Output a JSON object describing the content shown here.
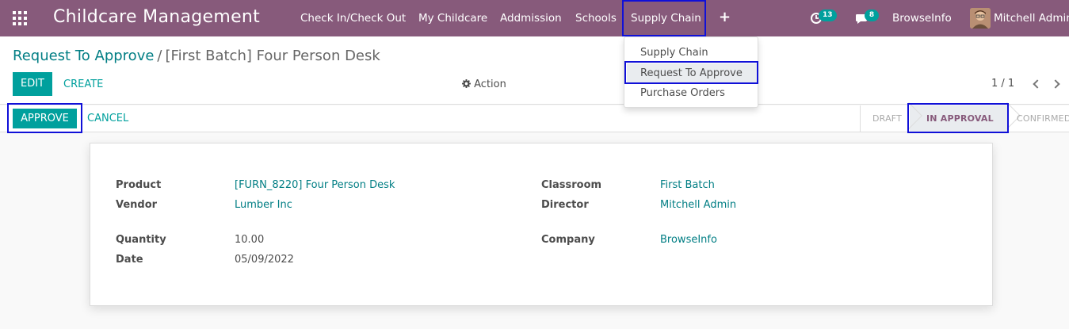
{
  "navbar": {
    "brand": "Childcare Management",
    "menu": [
      {
        "label": "Check In/Check Out"
      },
      {
        "label": "My Childcare"
      },
      {
        "label": "Addmission"
      },
      {
        "label": "Schools"
      },
      {
        "label": "Supply Chain"
      }
    ],
    "plus": "+",
    "activity_count": "13",
    "messages_count": "8",
    "company": "BrowseInfo",
    "user": "Mitchell Admin"
  },
  "dropdown": {
    "items": [
      {
        "label": "Supply Chain"
      },
      {
        "label": "Request To Approve"
      },
      {
        "label": "Purchase Orders"
      }
    ]
  },
  "breadcrumb": {
    "parent": "Request To Approve",
    "separator": "/",
    "current": "[First Batch] Four Person Desk"
  },
  "toolbar": {
    "edit": "EDIT",
    "create": "CREATE",
    "action": "Action",
    "pager": "1 / 1"
  },
  "statusbar": {
    "approve": "APPROVE",
    "cancel": "CANCEL",
    "stages": [
      {
        "label": "DRAFT"
      },
      {
        "label": "IN APPROVAL"
      },
      {
        "label": "CONFIRMED"
      }
    ]
  },
  "form": {
    "product_label": "Product",
    "product_value": "[FURN_8220] Four Person Desk",
    "vendor_label": "Vendor",
    "vendor_value": "Lumber Inc",
    "quantity_label": "Quantity",
    "quantity_value": "10.00",
    "date_label": "Date",
    "date_value": "05/09/2022",
    "classroom_label": "Classroom",
    "classroom_value": "First Batch",
    "director_label": "Director",
    "director_value": "Mitchell Admin",
    "company_label": "Company",
    "company_value": "BrowseInfo"
  },
  "colors": {
    "navbar": "#875a7b",
    "primary": "#00a09d",
    "link": "#017e84",
    "highlight": "#1010d8"
  }
}
